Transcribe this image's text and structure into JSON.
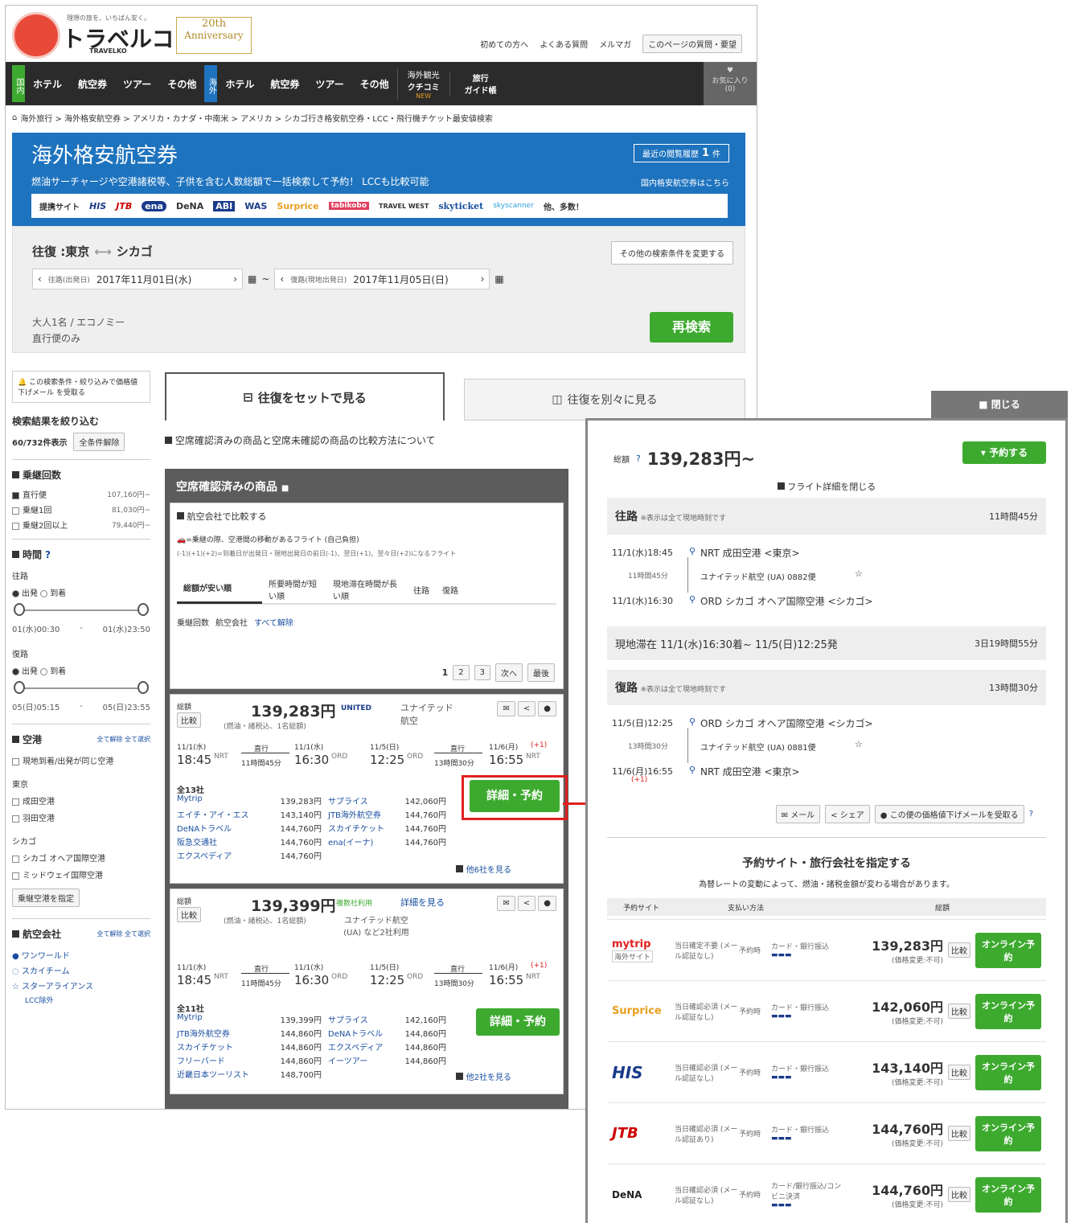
{
  "header": {
    "tagline": "理想の旅を、いちばん安く。",
    "logo_text": "トラベルコ",
    "logo_sub": "TRAVELKO",
    "anniv_line1": "20th",
    "anniv_line2": "Anniversary",
    "links": [
      "初めての方へ",
      "よくある質問",
      "メルマガ",
      "このページの質問・要望"
    ]
  },
  "nav": {
    "domestic_tag": "国内",
    "overseas_tag": "海外",
    "domestic_items": [
      "ホテル",
      "航空券",
      "ツアー",
      "その他"
    ],
    "overseas_items": [
      "ホテル",
      "航空券",
      "ツアー",
      "その他"
    ],
    "kuchikomi_line1": "海外観光",
    "kuchikomi_line2": "クチコミ",
    "kuchikomi_badge": "NEW",
    "guide_line1": "旅行",
    "guide_line2": "ガイド帳",
    "fav_label": "お気に入り",
    "fav_count": "(0)"
  },
  "breadcrumb": "海外旅行 > 海外格安航空券 > アメリカ・カナダ・中南米 > アメリカ > シカゴ行き格安航空券・LCC・飛行機チケット最安値検索",
  "banner": {
    "title": "海外格安航空券",
    "history_label": "最近の閲覧履歴",
    "history_count": "1",
    "history_unit": "件",
    "subtitle": "燃油サーチャージや空港諸税等、子供を含む人数総額で一括検索して予約！ LCCも比較可能",
    "domestic_link": "国内格安航空券はこちら",
    "partners_label": "提携サイト",
    "partners": [
      "HIS",
      "JTB",
      "ena",
      "DeNA",
      "ABI",
      "WAS",
      "Surprice",
      "tabikobo",
      "TRAVEL WEST",
      "skyticket",
      "skyscanner"
    ],
    "more": "他、多数！"
  },
  "search": {
    "route": "往復 :東京",
    "dest": "シカゴ",
    "change_btn": "その他の検索条件を変更する",
    "out_label": "往路(出発日)",
    "out_date": "2017年11月01日(水)",
    "ret_label": "復路(現地出発日)",
    "ret_date": "2017年11月05日(日)",
    "pax": "大人1名 / エコノミー",
    "direct": "直行便のみ",
    "research_btn": "再検索"
  },
  "sidebar": {
    "alert_text": "この検索条件・絞り込みで価格値下げメール",
    "alert_link": "を受取る",
    "filter_title": "検索結果を絞り込む",
    "count": "60/732件表示",
    "clear_all": "全条件解除",
    "transfer_title": "乗継回数",
    "transfers": [
      {
        "label": "直行便",
        "price": "107,160円~",
        "on": true
      },
      {
        "label": "乗継1回",
        "price": "81,030円~",
        "on": false
      },
      {
        "label": "乗継2回以上",
        "price": "79,440円~",
        "on": false
      }
    ],
    "time_title": "時間",
    "outbound": "往路",
    "inbound": "復路",
    "dep": "出発",
    "arr": "到着",
    "out_range_from": "01(水)00:30",
    "out_range_to": "01(水)23:50",
    "in_range_from": "05(日)05:15",
    "in_range_to": "05(日)23:55",
    "airport_title": "空港",
    "all_release": "全て解除",
    "all_check": "全て選択",
    "same_airport": "現地到着/出発が同じ空港",
    "tokyo": "東京",
    "narita": "成田空港",
    "haneda": "羽田空港",
    "chicago": "シカゴ",
    "ohare": "シカゴ オヘア国際空港",
    "midway": "ミッドウェイ国際空港",
    "transit_btn": "乗継空港を指定",
    "airline_title": "航空会社",
    "alliances": [
      "ワンワールド",
      "スカイチーム",
      "スターアライアンス"
    ],
    "lcc": "LCC除外"
  },
  "tabs": {
    "set": "往復をセットで見る",
    "separate": "往復を別々に見る"
  },
  "compare_note": "空席確認済みの商品と空席未確認の商品の比較方法について",
  "confirmed": {
    "title": "空席確認済みの商品",
    "compare_airlines": "航空会社で比較する",
    "legend1": "=乗継の際、空港間の移動があるフライト (自己負担)",
    "legend2": "(-1)(+1)(+2)=到着日が出発日・現地出発日の前日(-1)、翌日(+1)、翌々日(+2)になるフライト",
    "sorts": [
      "総額が安い順",
      "所要時間が短い順",
      "現地滞在時間が長い順",
      "往路",
      "復路"
    ],
    "filters": [
      "乗継回数",
      "航空会社",
      "すべて解除"
    ],
    "pages": [
      "1",
      "2",
      "3",
      "次へ",
      "最後"
    ]
  },
  "results": [
    {
      "total_label": "総額",
      "compare": "比較",
      "price": "139,283円",
      "note": "(燃油・諸税込、1名総額)",
      "airline": "ユナイテッド航空",
      "logo": "UNITED",
      "out_date": "11/1(水)",
      "out_dep": "18:45",
      "out_dep_ap": "NRT",
      "out_type": "直行",
      "out_dur": "11時間45分",
      "out_arr_date": "11/1(水)",
      "out_arr": "16:30",
      "out_arr_ap": "ORD",
      "ret_date": "11/5(日)",
      "ret_dep": "12:25",
      "ret_dep_ap": "ORD",
      "ret_type": "直行",
      "ret_dur": "13時間30分",
      "ret_arr_date": "11/6(月)",
      "ret_arr_plus": "(+1)",
      "ret_arr": "16:55",
      "ret_arr_ap": "NRT",
      "count": "全13社",
      "btn": "詳細・予約",
      "more": "他6社を見る",
      "deals": [
        [
          "Mytrip",
          "139,283円"
        ],
        [
          "サプライス",
          "142,060円"
        ],
        [
          "エイチ・アイ・エス",
          "143,140円"
        ],
        [
          "JTB海外航空券",
          "144,760円"
        ],
        [
          "DeNAトラベル",
          "144,760円"
        ],
        [
          "スカイチケット",
          "144,760円"
        ],
        [
          "阪急交通社",
          "144,760円"
        ],
        [
          "ena(イーナ)",
          "144,760円"
        ],
        [
          "エクスペディア",
          "144,760円"
        ],
        [
          "",
          ""
        ]
      ]
    },
    {
      "total_label": "総額",
      "compare": "比較",
      "price": "139,399円",
      "note": "(燃油・諸税込、1名総額)",
      "airline": "ユナイテッド航空(UA) など2社利用",
      "logo": "複数社利用",
      "detail_link": "詳細を見る",
      "out_date": "11/1(水)",
      "out_dep": "18:45",
      "out_dep_ap": "NRT",
      "out_type": "直行",
      "out_dur": "11時間45分",
      "out_arr_date": "11/1(水)",
      "out_arr": "16:30",
      "out_arr_ap": "ORD",
      "ret_date": "11/5(日)",
      "ret_dep": "12:25",
      "ret_dep_ap": "ORD",
      "ret_type": "直行",
      "ret_dur": "13時間30分",
      "ret_arr_date": "11/6(月)",
      "ret_arr_plus": "(+1)",
      "ret_arr": "16:55",
      "ret_arr_ap": "NRT",
      "count": "全11社",
      "btn": "詳細・予約",
      "more": "他2社を見る",
      "deals": [
        [
          "Mytrip",
          "139,399円"
        ],
        [
          "サプライス",
          "142,160円"
        ],
        [
          "JTB海外航空券",
          "144,860円"
        ],
        [
          "DeNAトラベル",
          "144,860円"
        ],
        [
          "スカイチケット",
          "144,860円"
        ],
        [
          "エクスペディア",
          "144,860円"
        ],
        [
          "フリーバード",
          "144,860円"
        ],
        [
          "イーツアー",
          "144,860円"
        ],
        [
          "近畿日本ツーリスト",
          "148,700円"
        ],
        [
          "",
          ""
        ]
      ]
    }
  ],
  "detail": {
    "close": "閉じる",
    "total_label": "総額",
    "total": "139,283円~",
    "reserve_btn": "予約する",
    "collapse": "フライト詳細を閉じる",
    "outbound_title": "往路",
    "time_note": "※表示は全て現地時刻です",
    "out_total": "11時間45分",
    "out_dep": "11/1(水)18:45",
    "out_dep_ap": "NRT 成田空港 <東京>",
    "out_flight_dur": "11時間45分",
    "out_flight": "ユナイテッド航空 (UA) 0882便",
    "out_arr": "11/1(水)16:30",
    "out_arr_ap": "ORD シカゴ オヘア国際空港 <シカゴ>",
    "stay_title": "現地滞在 11/1(水)16:30着~ 11/5(日)12:25発",
    "stay_dur": "3日19時間55分",
    "inbound_title": "復路",
    "in_total": "13時間30分",
    "in_dep": "11/5(日)12:25",
    "in_dep_ap": "ORD シカゴ オヘア国際空港 <シカゴ>",
    "in_flight_dur": "13時間30分",
    "in_flight": "ユナイテッド航空 (UA) 0881便",
    "in_arr": "11/6(月)16:55",
    "in_arr_plus": "(+1)",
    "in_arr_ap": "NRT 成田空港 <東京>",
    "mail": "メール",
    "share": "シェア",
    "alert": "この便の価格値下げメールを受取る",
    "sites_title": "予約サイト・旅行会社を指定する",
    "sites_note": "為替レートの変動によって、燃油・諸税金額が変わる場合があります。",
    "cols": [
      "予約サイト",
      "支払い方法",
      "総額"
    ],
    "sites": [
      {
        "name": "mytrip",
        "badge": "海外サイト",
        "cond": "当日確定不要 (メール認証なし)",
        "payment": "予約時",
        "method": "カード・銀行振込",
        "price": "139,283円",
        "note": "(価格変更:不可)",
        "btn": "オンライン予約"
      },
      {
        "name": "Surprice",
        "badge": "",
        "cond": "当日確認必須 (メール認証なし)",
        "payment": "予約時",
        "method": "カード・銀行振込",
        "price": "142,060円",
        "note": "(価格変更:不可)",
        "btn": "オンライン予約"
      },
      {
        "name": "HIS",
        "badge": "",
        "cond": "当日確認必須 (メール認証なし)",
        "payment": "予約時",
        "method": "カード・銀行振込",
        "price": "143,140円",
        "note": "(価格変更:不可)",
        "btn": "オンライン予約"
      },
      {
        "name": "JTB",
        "badge": "",
        "cond": "当日確認必須 (メール認証あり)",
        "payment": "予約時",
        "method": "カード・銀行振込",
        "price": "144,760円",
        "note": "(価格変更:不可)",
        "btn": "オンライン予約"
      },
      {
        "name": "DeNA",
        "badge": "",
        "cond": "当日確認必須 (メール認証なし)",
        "payment": "予約時",
        "method": "カード/銀行振込/コンビニ決済",
        "price": "144,760円",
        "note": "(価格変更:不可)",
        "btn": "オンライン予約"
      }
    ],
    "compare": "比較"
  },
  "colors": {
    "nav": "#2b2b2b",
    "banner": "#1e73be",
    "green": "#3daa2f",
    "red": "#e02020",
    "link": "#1a4fa0"
  }
}
